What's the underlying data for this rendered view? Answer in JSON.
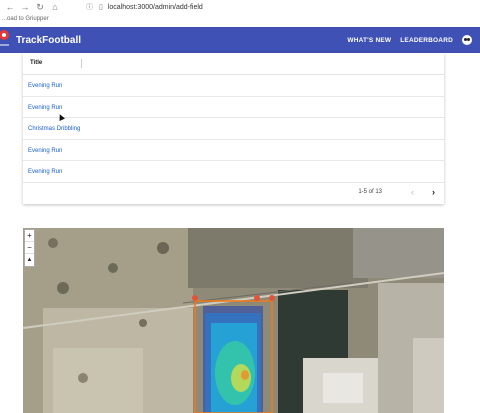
{
  "browser": {
    "url": "localhost:3000/admin/add-field",
    "bookmark": "...oad to Griupper"
  },
  "appbar": {
    "brand": "TrackFootball",
    "whats_new": "WHAT'S NEW",
    "leaderboard": "LEADERBOARD"
  },
  "table": {
    "header": "Title",
    "rows": [
      "Evening Run",
      "Evening Run",
      "Christmas Dribbling",
      "Evening Run",
      "Evening Run"
    ],
    "pagination": "1-5 of 13"
  },
  "map": {
    "zoom_in": "+",
    "zoom_out": "−",
    "reset": "▲"
  }
}
